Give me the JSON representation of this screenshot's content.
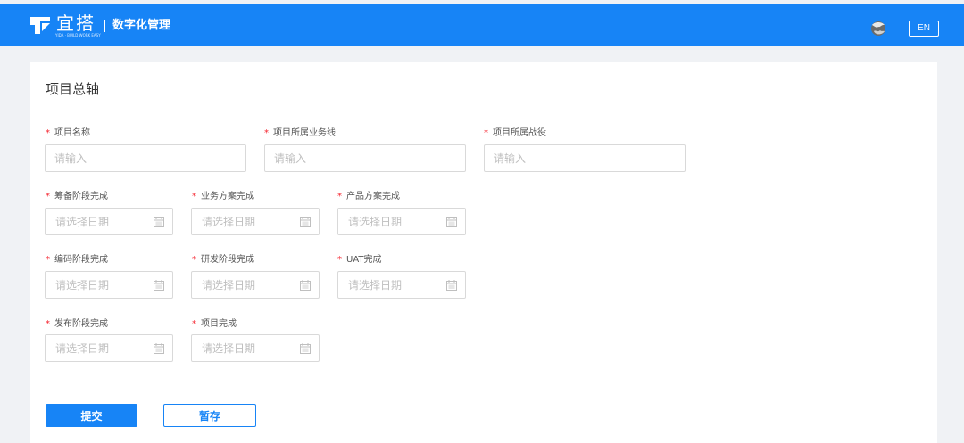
{
  "header": {
    "brand": "宜搭",
    "brand_sub": "YIDA · BUILD WORK EASY",
    "app_name": "数字化管理",
    "lang_button": "EN",
    "colors": {
      "primary": "#1784f6",
      "required": "#f5222d"
    }
  },
  "form": {
    "title": "项目总轴",
    "required_mark": "*",
    "fields": {
      "project_name": {
        "label": "项目名称",
        "placeholder": "请输入"
      },
      "business_line": {
        "label": "项目所属业务线",
        "placeholder": "请输入"
      },
      "campaign": {
        "label": "项目所属战役",
        "placeholder": "请输入"
      },
      "prep_stage": {
        "label": "筹备阶段完成",
        "placeholder": "请选择日期"
      },
      "biz_plan": {
        "label": "业务方案完成",
        "placeholder": "请选择日期"
      },
      "product_plan": {
        "label": "产品方案完成",
        "placeholder": "请选择日期"
      },
      "coding_stage": {
        "label": "编码阶段完成",
        "placeholder": "请选择日期"
      },
      "dev_stage": {
        "label": "研发阶段完成",
        "placeholder": "请选择日期"
      },
      "uat": {
        "label": "UAT完成",
        "placeholder": "请选择日期"
      },
      "release_stage": {
        "label": "发布阶段完成",
        "placeholder": "请选择日期"
      },
      "project_done": {
        "label": "项目完成",
        "placeholder": "请选择日期"
      }
    },
    "buttons": {
      "submit": "提交",
      "draft": "暂存"
    }
  }
}
